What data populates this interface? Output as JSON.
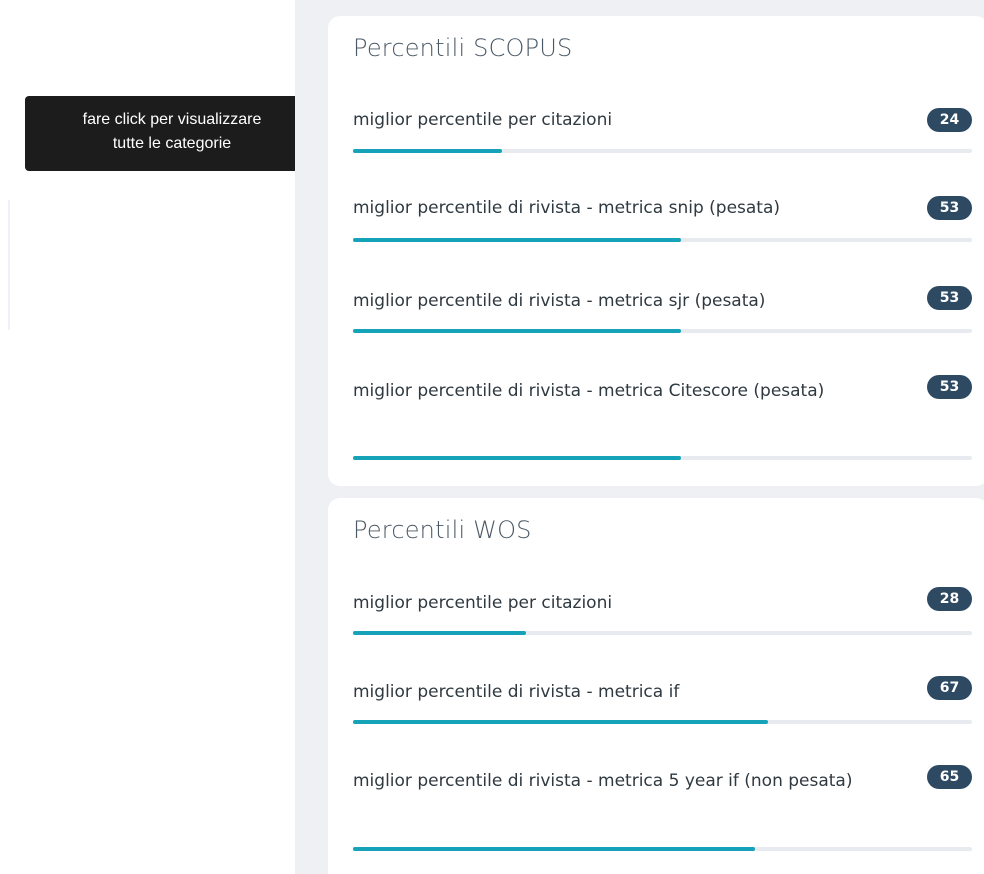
{
  "tooltip": {
    "line1": "fare click per visualizzare",
    "line2": "tutte le categorie"
  },
  "cards": [
    {
      "title": "Percentili SCOPUS",
      "metrics": [
        {
          "label": "miglior percentile per citazioni",
          "value": "24",
          "percent": 24
        },
        {
          "label": "miglior percentile di rivista - metrica snip (pesata)",
          "value": "53",
          "percent": 53
        },
        {
          "label": "miglior percentile di rivista - metrica sjr (pesata)",
          "value": "53",
          "percent": 53
        },
        {
          "label": "miglior percentile di rivista - metrica Citescore (pesata)",
          "value": "53",
          "percent": 53
        }
      ]
    },
    {
      "title": "Percentili WOS",
      "metrics": [
        {
          "label": "miglior percentile per citazioni",
          "value": "28",
          "percent": 28
        },
        {
          "label": "miglior percentile di rivista - metrica if",
          "value": "67",
          "percent": 67
        },
        {
          "label": "miglior percentile di rivista - metrica 5 year if (non pesata)",
          "value": "65",
          "percent": 65
        }
      ]
    }
  ],
  "colors": {
    "accent": "#16a2b8",
    "badge": "#2e4a63",
    "tooltip_bg": "#1c1c1c",
    "panel_bg": "#eef0f4"
  }
}
